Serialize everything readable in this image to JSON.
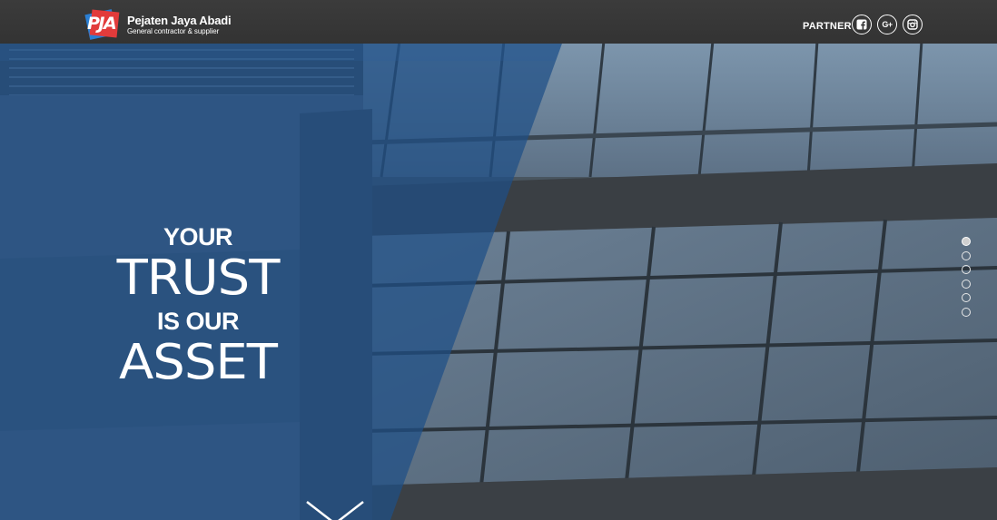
{
  "header": {
    "logo_text": "PJA",
    "brand_name": "Pejaten Jaya Abadi",
    "brand_tagline": "General contractor & supplier",
    "partner_label": "PARTNER",
    "social": [
      {
        "name": "facebook",
        "icon": "facebook-icon"
      },
      {
        "name": "google-plus",
        "icon": "google-plus-icon",
        "glyph": "G+"
      },
      {
        "name": "instagram",
        "icon": "instagram-icon"
      }
    ]
  },
  "hero": {
    "slogan": {
      "line1": "YOUR",
      "line2": "TRUST",
      "line3": "IS OUR",
      "line4": "ASSET"
    },
    "slider": {
      "total_slides": 6,
      "active_slide": 1
    },
    "scroll_icon": "chevron-down-icon"
  },
  "colors": {
    "header_bg": "#363636",
    "overlay_blue": "#1f4f86",
    "brand_red": "#e23b3b",
    "brand_blue": "#2a7fd4"
  }
}
